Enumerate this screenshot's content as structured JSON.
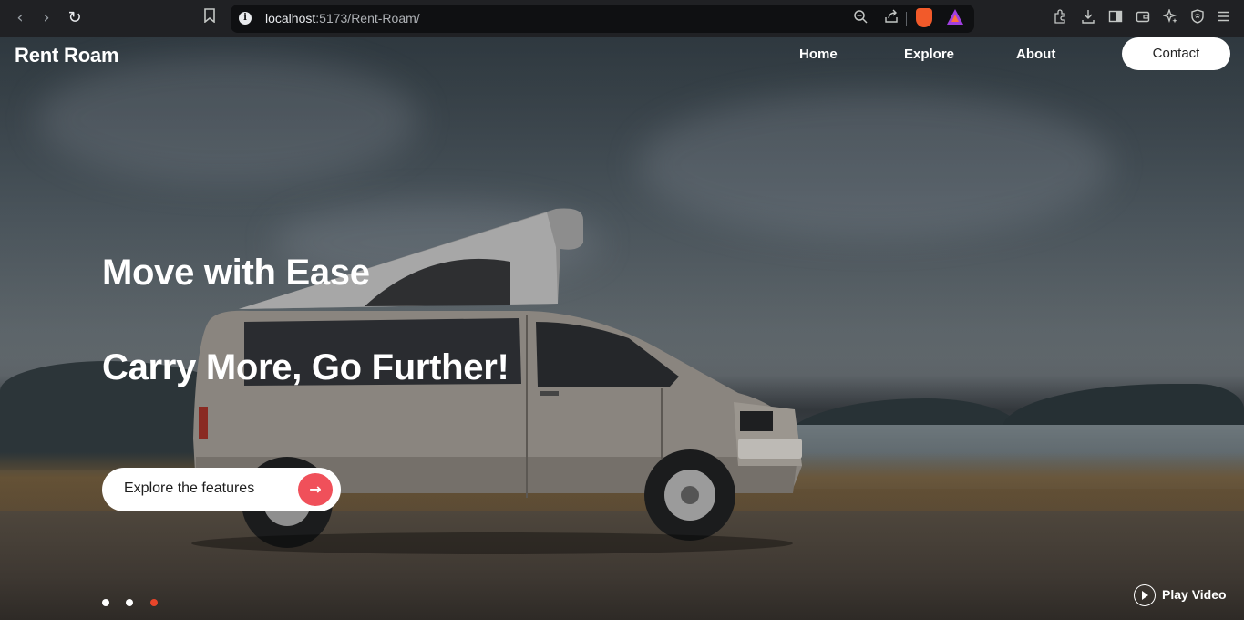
{
  "browser": {
    "url_host": "localhost",
    "url_path": ":5173/Rent-Roam/",
    "icons": [
      "back-icon",
      "forward-icon",
      "reload-icon",
      "bookmark-icon",
      "info-icon",
      "zoom-icon",
      "share-icon",
      "brave-shields-icon",
      "brave-rewards-icon",
      "extensions-icon",
      "downloads-icon",
      "sidebar-icon",
      "wallet-icon",
      "leo-ai-icon",
      "vpn-icon",
      "menu-icon"
    ]
  },
  "nav": {
    "brand": "Rent Roam",
    "links": [
      "Home",
      "Explore",
      "About"
    ],
    "contact": "Contact"
  },
  "hero": {
    "headline_1": "Move with Ease",
    "headline_2": "Carry More, Go Further!",
    "cta_label": "Explore the features",
    "cta_icon": "arrow-right-icon",
    "slides": 3,
    "active_slide": 3,
    "play_label": "Play Video"
  },
  "colors": {
    "accent": "#f0505a",
    "active_dot": "#e8452a"
  }
}
